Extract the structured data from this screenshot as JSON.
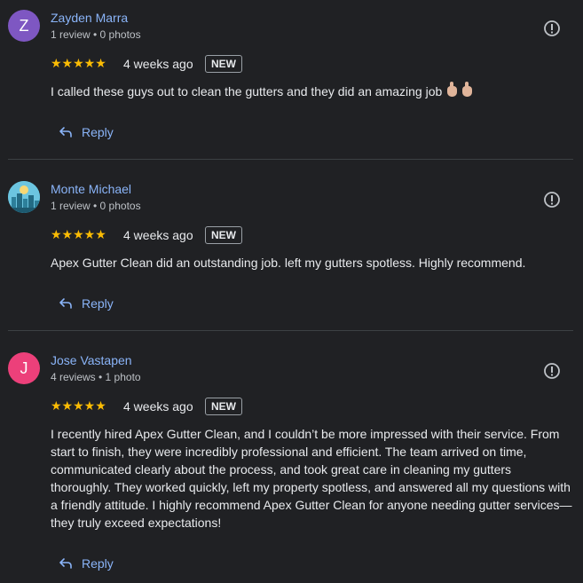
{
  "reviews": [
    {
      "avatar_letter": "Z",
      "avatar_color": "#7e57c2",
      "name": "Zayden Marra",
      "meta": "1 review • 0 photos",
      "stars": "★★★★★",
      "rating": 5,
      "time": "4 weeks ago",
      "badge": "NEW",
      "text": "I called these guys out to clean the gutters and they did an amazing job",
      "emojis": [
        "thumbs-up-emoji",
        "thumbs-up-emoji"
      ],
      "reply": "Reply"
    },
    {
      "avatar_color": "#3fa7c9",
      "name": "Monte Michael",
      "meta": "1 review • 0 photos",
      "stars": "★★★★★",
      "rating": 5,
      "time": "4 weeks ago",
      "badge": "NEW",
      "text": "Apex Gutter Clean did an outstanding job. left my gutters spotless. Highly recommend.",
      "reply": "Reply"
    },
    {
      "avatar_letter": "J",
      "avatar_color": "#ec407a",
      "name": "Jose Vastapen",
      "meta": "4 reviews • 1 photo",
      "stars": "★★★★★",
      "rating": 5,
      "time": "4 weeks ago",
      "badge": "NEW",
      "text": "I recently hired Apex Gutter Clean, and I couldn’t be more impressed with their service. From start to finish, they were incredibly professional and efficient. The team arrived on time, communicated clearly about the process, and took great care in cleaning my gutters thoroughly. They worked quickly, left my property spotless, and answered all my questions with a friendly attitude. I highly recommend Apex Gutter Clean for anyone needing gutter services—they truly exceed expectations!",
      "reply": "Reply"
    }
  ]
}
